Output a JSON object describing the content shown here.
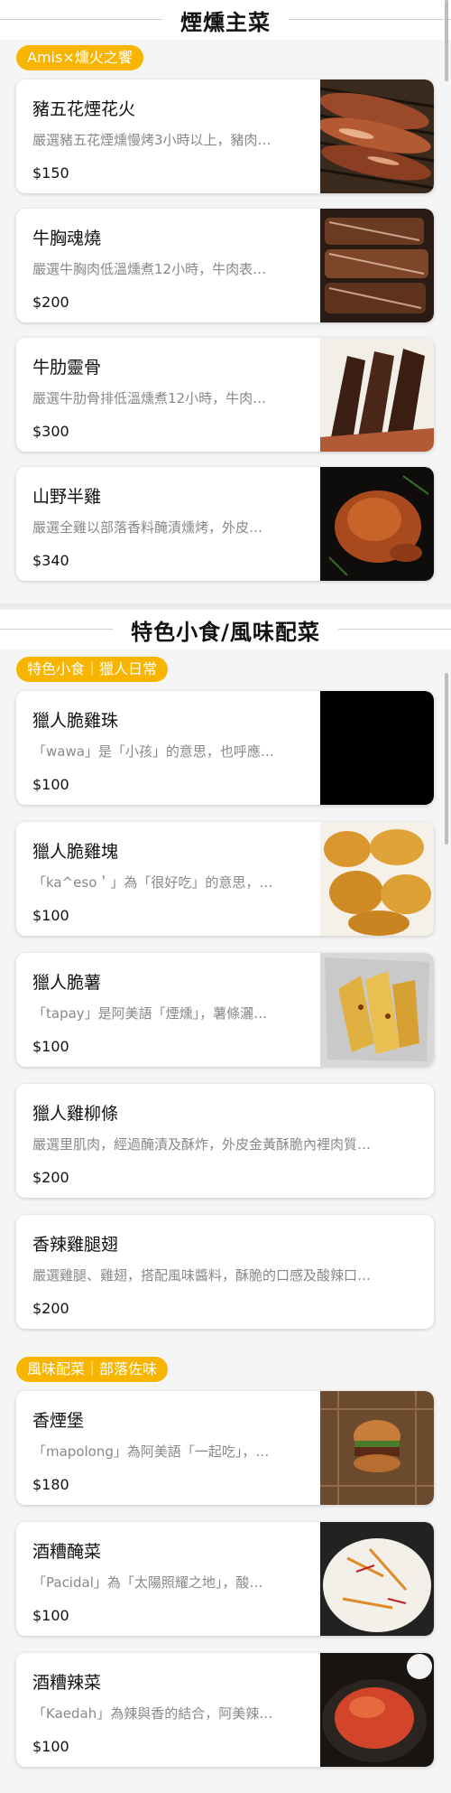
{
  "sections": [
    {
      "title": "煙燻主菜",
      "groups": [
        {
          "tag": "Amis×燻火之饗",
          "items": [
            {
              "name": "豬五花煙花火",
              "desc": "嚴選豬五花煙燻慢烤3小時以上，豬肉…",
              "price": "$150",
              "image": "bacon-grill-photo"
            },
            {
              "name": "牛胸魂燒",
              "desc": "嚴選牛胸肉低溫燻煮12小時，牛肉表…",
              "price": "$200",
              "image": "brisket-photo"
            },
            {
              "name": "牛肋靈骨",
              "desc": "嚴選牛肋骨排低溫燻煮12小時，牛肉…",
              "price": "$300",
              "image": "beef-rib-photo"
            },
            {
              "name": "山野半雞",
              "desc": "嚴選全雞以部落香料醃漬燻烤，外皮…",
              "price": "$340",
              "image": "roast-chicken-photo"
            }
          ]
        }
      ]
    },
    {
      "title": "特色小食/風味配菜",
      "groups": [
        {
          "tag": "特色小食｜獵人日常",
          "items": [
            {
              "name": "獵人脆雞珠",
              "desc": "「wawa」是「小孩」的意思，也呼應…",
              "price": "$100",
              "image": "black-placeholder"
            },
            {
              "name": "獵人脆雞塊",
              "desc": "「ka^eso＇」為「很好吃」的意思，…",
              "price": "$100",
              "image": "nuggets-photo"
            },
            {
              "name": "獵人脆薯",
              "desc": "「tapay」是阿美語「煙燻」，薯條灑…",
              "price": "$100",
              "image": "potato-wedges-photo"
            },
            {
              "name": "獵人雞柳條",
              "desc": "嚴選里肌肉，經過醃漬及酥炸，外皮金黃酥脆內裡肉質…",
              "price": "$200",
              "image": ""
            },
            {
              "name": "香辣雞腿翅",
              "desc": "嚴選雞腿、雞翅，搭配風味醬料，酥脆的口感及酸辣口…",
              "price": "$200",
              "image": ""
            }
          ]
        },
        {
          "tag": "風味配菜｜部落佐味",
          "items": [
            {
              "name": "香煙堡",
              "desc": "「mapolong」為阿美語「一起吃」，…",
              "price": "$180",
              "image": "burger-paper-photo"
            },
            {
              "name": "酒糟醃菜",
              "desc": "「Pacidal」為「太陽照耀之地」，酸…",
              "price": "$100",
              "image": "pickled-cabbage-photo"
            },
            {
              "name": "酒糟辣菜",
              "desc": "「Kaedah」為辣與香的結合，阿美辣…",
              "price": "$100",
              "image": "spicy-kimchi-photo"
            }
          ]
        }
      ]
    }
  ],
  "colors": {
    "accent": "#f7b500",
    "background": "#f5f5f5",
    "card": "#ffffff",
    "muted_text": "#888888"
  }
}
